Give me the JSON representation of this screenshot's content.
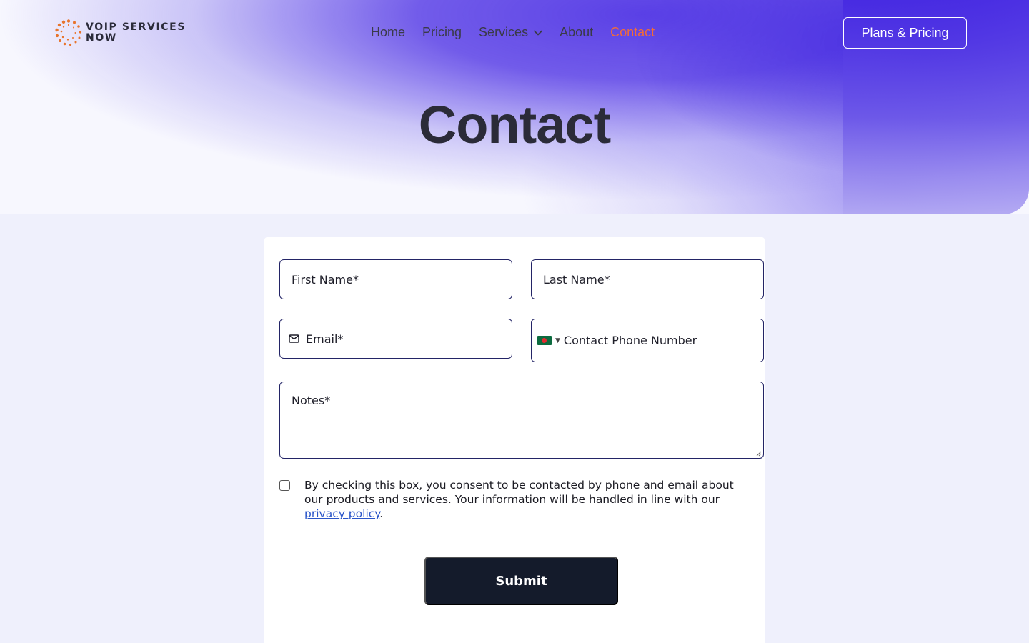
{
  "brand": {
    "line1": "VOIP SERVICES",
    "line2": "NOW",
    "logo_icon": "dotted-ring-logo"
  },
  "nav": {
    "items": [
      {
        "label": "Home"
      },
      {
        "label": "Pricing"
      },
      {
        "label": "Services"
      },
      {
        "label": "About"
      },
      {
        "label": "Contact"
      }
    ],
    "active": "Contact",
    "cta_label": "Plans & Pricing"
  },
  "hero": {
    "title": "Contact"
  },
  "form": {
    "first_name_placeholder": "First Name*",
    "last_name_placeholder": "Last Name*",
    "email_placeholder": "Email*",
    "email_icon": "envelope-icon",
    "phone_placeholder": "Contact Phone Number",
    "phone_country_flag": "bangladesh-flag-icon",
    "notes_placeholder": "Notes*",
    "consent_text": "By checking this box, you consent to be contacted by phone and email about our products and services. Your information will be handled in line with our ",
    "consent_link": "privacy policy",
    "consent_suffix": ".",
    "consent_checked": false,
    "submit_label": "Submit"
  },
  "colors": {
    "accent": "#4328e0",
    "active_nav": "#f26b38",
    "submit_bg": "#141b2b",
    "field_border": "#232466",
    "link": "#2b56c9",
    "logo_orange": "#e8742c"
  }
}
